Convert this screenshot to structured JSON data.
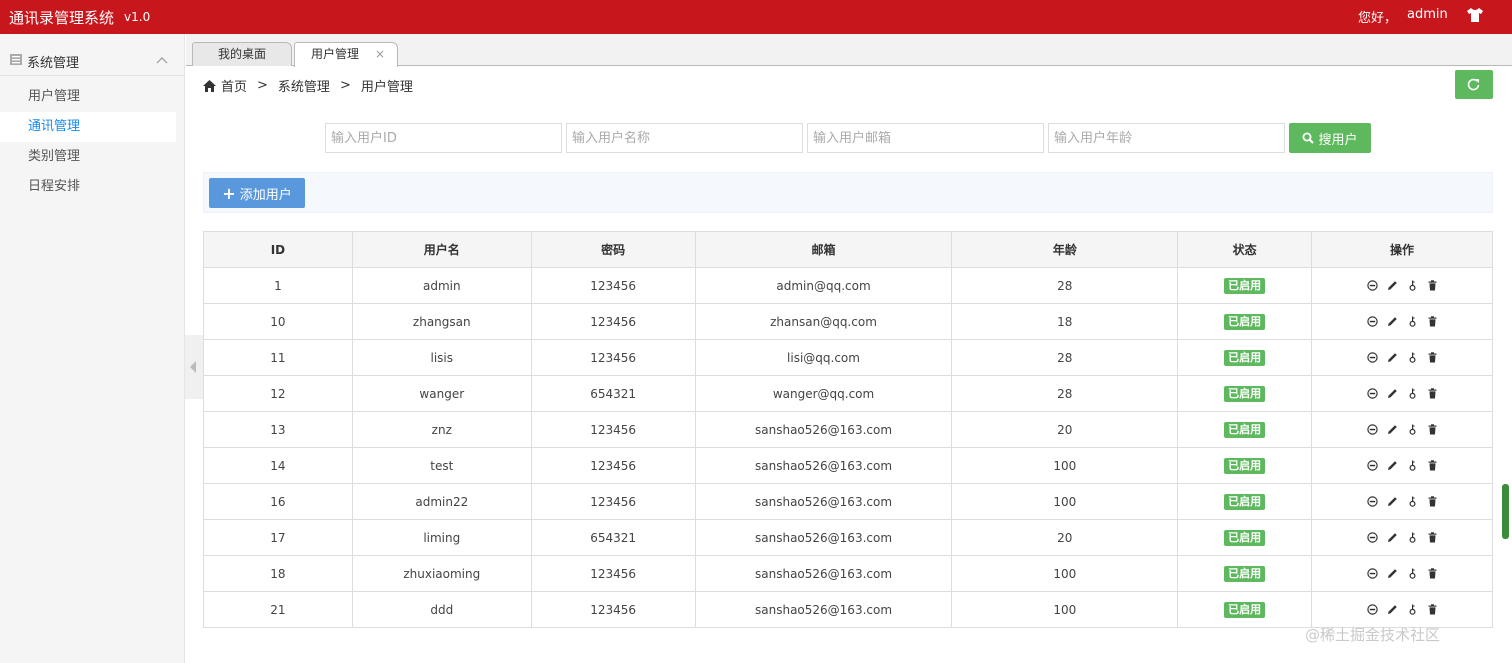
{
  "header": {
    "title": "通讯录管理系统",
    "version": "v1.0",
    "greeting": "您好，",
    "username": "admin"
  },
  "sidebar": {
    "section_label": "系统管理",
    "items": [
      {
        "label": "用户管理",
        "active": false
      },
      {
        "label": "通讯管理",
        "active": true
      },
      {
        "label": "类别管理",
        "active": false
      },
      {
        "label": "日程安排",
        "active": false
      }
    ]
  },
  "tabs": [
    {
      "label": "我的桌面"
    },
    {
      "label": "用户管理",
      "close": "×"
    }
  ],
  "breadcrumb": {
    "home": "首页",
    "sep": ">",
    "level1": "系统管理",
    "level2": "用户管理"
  },
  "search": {
    "id_placeholder": "输入用户ID",
    "name_placeholder": "输入用户名称",
    "email_placeholder": "输入用户邮箱",
    "age_placeholder": "输入用户年龄",
    "button_label": "搜用户"
  },
  "toolbar": {
    "add_label": "添加用户"
  },
  "table": {
    "headers": [
      "ID",
      "用户名",
      "密码",
      "邮箱",
      "年龄",
      "状态",
      "操作"
    ],
    "rows": [
      {
        "id": "1",
        "name": "admin",
        "password": "123456",
        "email": "admin@qq.com",
        "age": "28",
        "status": "已启用"
      },
      {
        "id": "10",
        "name": "zhangsan",
        "password": "123456",
        "email": "zhansan@qq.com",
        "age": "18",
        "status": "已启用"
      },
      {
        "id": "11",
        "name": "lisis",
        "password": "123456",
        "email": "lisi@qq.com",
        "age": "28",
        "status": "已启用"
      },
      {
        "id": "12",
        "name": "wanger",
        "password": "654321",
        "email": "wanger@qq.com",
        "age": "28",
        "status": "已启用"
      },
      {
        "id": "13",
        "name": "znz",
        "password": "123456",
        "email": "sanshao526@163.com",
        "age": "20",
        "status": "已启用"
      },
      {
        "id": "14",
        "name": "test",
        "password": "123456",
        "email": "sanshao526@163.com",
        "age": "100",
        "status": "已启用"
      },
      {
        "id": "16",
        "name": "admin22",
        "password": "123456",
        "email": "sanshao526@163.com",
        "age": "100",
        "status": "已启用"
      },
      {
        "id": "17",
        "name": "liming",
        "password": "654321",
        "email": "sanshao526@163.com",
        "age": "20",
        "status": "已启用"
      },
      {
        "id": "18",
        "name": "zhuxiaoming",
        "password": "123456",
        "email": "sanshao526@163.com",
        "age": "100",
        "status": "已启用"
      },
      {
        "id": "21",
        "name": "ddd",
        "password": "123456",
        "email": "sanshao526@163.com",
        "age": "100",
        "status": "已启用"
      }
    ],
    "row_actions": [
      "disable-icon",
      "edit-icon",
      "key-icon",
      "trash-icon"
    ]
  },
  "watermark": "@稀土掘金技术社区",
  "colors": {
    "topbar": "#c8161d",
    "accent_blue": "#148cf1",
    "green": "#5eb95e",
    "add_blue": "#5a98de"
  }
}
